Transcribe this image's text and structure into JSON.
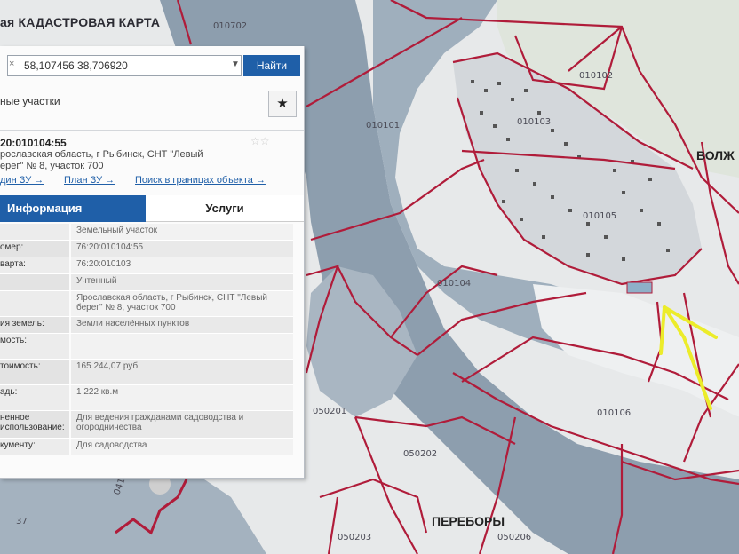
{
  "app": {
    "title": "ая КАДАСТРОВАЯ КАРТА"
  },
  "search": {
    "value": "58,107456 38,706920",
    "clear_icon": "×",
    "dropdown_icon": "▼",
    "button_label": "Найти"
  },
  "panel": {
    "section_title": "ные участки",
    "favorite_icon": "★",
    "parcel": {
      "number": "20:010104:55",
      "rating": "☆☆",
      "address_line1": "рославская область, г Рыбинск, СНТ \"Левый",
      "address_line2": "ерег\" № 8, участок 700"
    },
    "links": [
      "дин ЗУ →",
      "План ЗУ →",
      "Поиск в границах объекта →"
    ],
    "tabs": {
      "info": "Информация",
      "services": "Услуги"
    },
    "rows": [
      {
        "label": "",
        "value": "Земельный участок"
      },
      {
        "label": "омер:",
        "value": "76:20:010104:55"
      },
      {
        "label": "варта:",
        "value": "76:20:010103"
      },
      {
        "label": "",
        "value": "Учтенный"
      },
      {
        "label": "",
        "value": "Ярославская область, г Рыбинск, СНТ \"Левый берег\" № 8, участок 700"
      },
      {
        "label": "ия земель:",
        "value": "Земли населённых пунктов"
      },
      {
        "label": "мость:",
        "value": ""
      },
      {
        "label": "тоимость:",
        "value": "165 244,07 руб."
      },
      {
        "label": "адь:",
        "value": "1 222 кв.м"
      },
      {
        "label": "ненное использование:",
        "value": "Для ведения гражданами садоводства и огородничества"
      },
      {
        "label": "кументу:",
        "value": "Для садоводства"
      }
    ]
  },
  "map": {
    "labels": [
      "010702",
      "010102",
      "010103",
      "010101",
      "010105",
      "010104",
      "010106",
      "050201",
      "050202",
      "050203",
      "050206",
      "041",
      "37"
    ],
    "places": [
      "ВОЛЖ",
      "ПЕРЕБОРЫ"
    ],
    "colors": {
      "water": "#8fa0af",
      "land": "#e7e9ea",
      "settlement": "#d7dadd",
      "boundary": "#b01c3a",
      "marker": "#ecec2a"
    }
  }
}
